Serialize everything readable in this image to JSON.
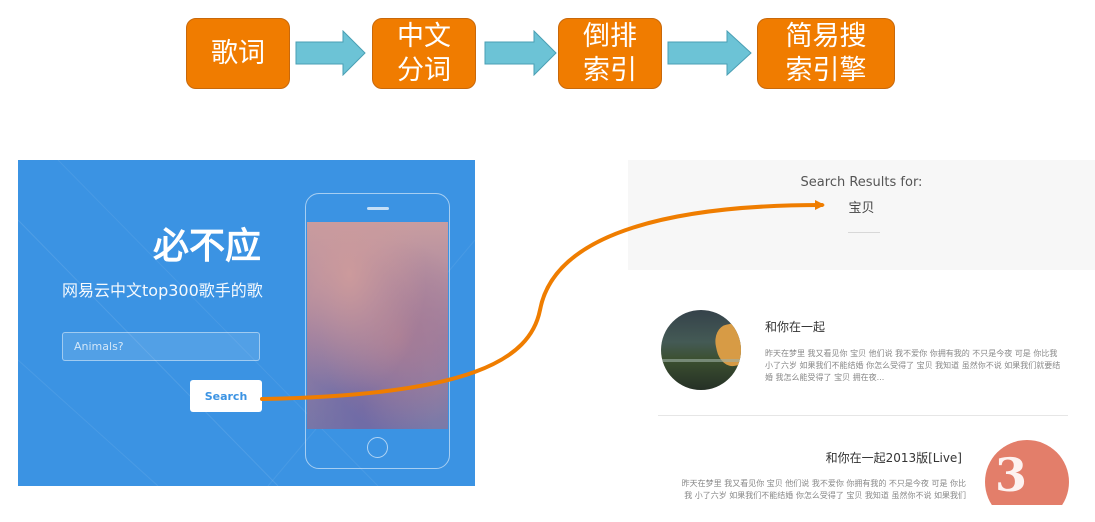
{
  "pipeline": {
    "steps": [
      {
        "lines": [
          "歌词"
        ]
      },
      {
        "lines": [
          "中文",
          "分词"
        ]
      },
      {
        "lines": [
          "倒排",
          "索引"
        ]
      },
      {
        "lines": [
          "简易搜",
          "索引擎"
        ]
      }
    ]
  },
  "left": {
    "brand": "必不应",
    "subtitle": "网易云中文top300歌手的歌",
    "search_placeholder": "Animals?",
    "search_button": "Search"
  },
  "right": {
    "header_title": "Search Results for:",
    "query": "宝贝",
    "results": [
      {
        "title": "和你在一起",
        "lyrics": "昨天在梦里 我又看见你 宝贝 他们说 我不爱你 你拥有我的 不只是今夜 可是 你比我 小了六岁 如果我们不能结婚 你怎么受得了 宝贝 我知道 虽然你不说 如果我们就要结婚 我怎么能受得了 宝贝 拥在夜..."
      },
      {
        "title": "和你在一起2013版[Live]",
        "lyrics": "昨天在梦里 我又看见你 宝贝 他们说 我不爱你 你拥有我的 不只是今夜 可是 你比我 小了六岁 如果我们不能结婚 你怎么受得了 宝贝 我知道 虽然你不说 如果我们"
      }
    ]
  },
  "colors": {
    "step_fill": "#f07c00",
    "arrow_fill": "#6cc3d6",
    "left_bg": "#3b93e3",
    "connector": "#ef7d00"
  }
}
